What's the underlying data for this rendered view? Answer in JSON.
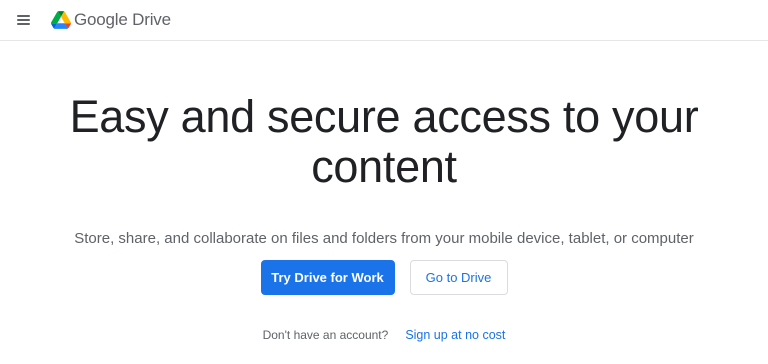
{
  "header": {
    "brand_google": "Google",
    "brand_product": "Drive"
  },
  "hero": {
    "headline": "Easy and secure access to your content",
    "subtitle": "Store, share, and collaborate on files and folders from your mobile device, tablet, or computer"
  },
  "actions": {
    "primary_label": "Try Drive for Work",
    "secondary_label": "Go to Drive"
  },
  "signup": {
    "prompt": "Don't have an account?",
    "link_label": "Sign up at no cost"
  },
  "colors": {
    "accent": "#1a73e8",
    "text_primary": "#202124",
    "text_secondary": "#5f6368",
    "divider": "#e6e6e6"
  },
  "icons": {
    "menu": "hamburger-menu-icon",
    "logo": "google-drive-logo-icon"
  }
}
